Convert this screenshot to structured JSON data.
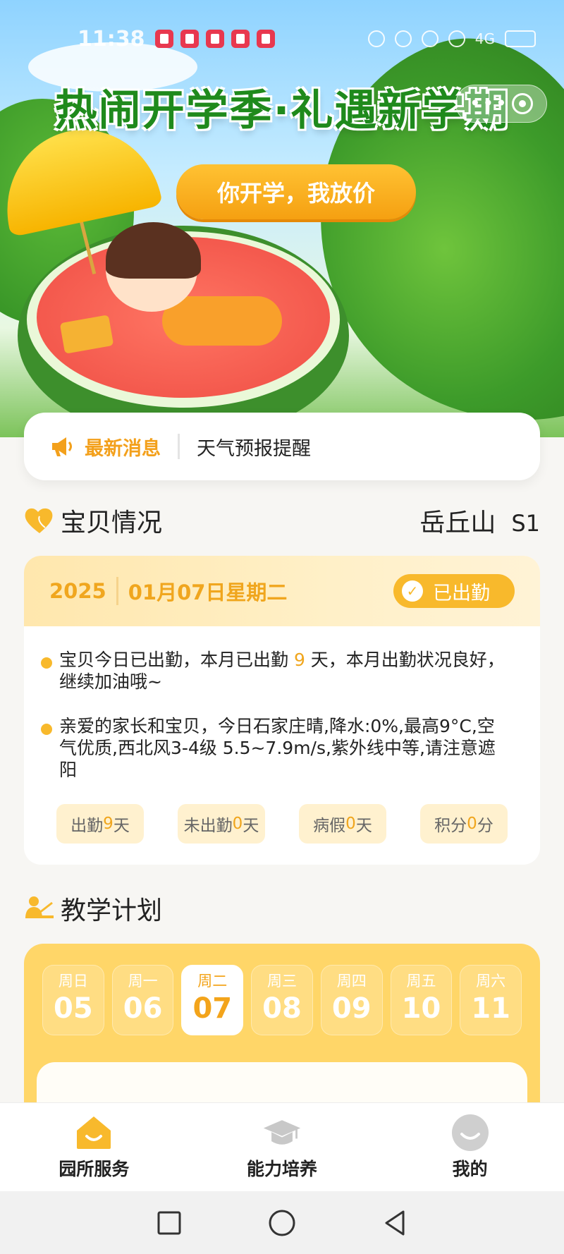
{
  "status_bar": {
    "time": "11:38",
    "network": "4G"
  },
  "banner": {
    "title": "热闹开学季·礼遇新学期",
    "pill_text": "你开学，我放价"
  },
  "news": {
    "icon": "horn-icon",
    "label": "最新消息",
    "text": "天气预报提醒"
  },
  "baby_section": {
    "icon": "heart-icon",
    "title": "宝贝情况",
    "child_name": "岳丘山",
    "class_name": "S1"
  },
  "baby_card": {
    "year": "2025",
    "date": "01月07日星期二",
    "attendance_status": "已出勤",
    "bullet1": {
      "before": "宝贝今日已出勤，本月已出勤 ",
      "days": "9",
      "after": " 天，本月出勤状况良好，继续加油哦~"
    },
    "bullet2": "亲爱的家长和宝贝，今日石家庄晴,降水:0%,最高9°C,空气优质,西北风3-4级 5.5~7.9m/s,紫外线中等,请注意遮阳",
    "stats": [
      {
        "label": "出勤",
        "value": "9",
        "unit": "天"
      },
      {
        "label": "未出勤",
        "value": "0",
        "unit": "天"
      },
      {
        "label": "病假",
        "value": "0",
        "unit": "天"
      },
      {
        "label": "积分",
        "value": "0",
        "unit": "分"
      }
    ]
  },
  "plan_section": {
    "icon": "teacher-icon",
    "title": "教学计划",
    "days": [
      {
        "weekday": "周日",
        "date": "05"
      },
      {
        "weekday": "周一",
        "date": "06"
      },
      {
        "weekday": "周二",
        "date": "07"
      },
      {
        "weekday": "周三",
        "date": "08"
      },
      {
        "weekday": "周四",
        "date": "09"
      },
      {
        "weekday": "周五",
        "date": "10"
      },
      {
        "weekday": "周六",
        "date": "11"
      }
    ],
    "selected_index": 2
  },
  "bottom_nav": [
    {
      "label": "园所服务",
      "icon": "home-icon"
    },
    {
      "label": "能力培养",
      "icon": "graduation-cap-icon"
    },
    {
      "label": "我的",
      "icon": "profile-icon"
    }
  ],
  "colors": {
    "accent": "#f8b92c",
    "accent_text": "#f0a61e",
    "plan_bg": "#ffd668"
  }
}
